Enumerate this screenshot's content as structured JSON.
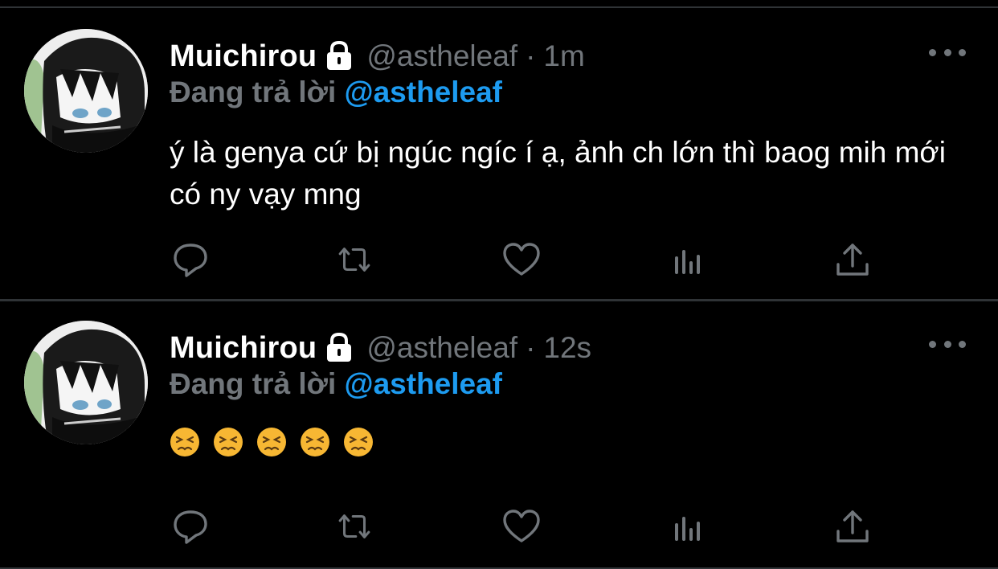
{
  "tweets": [
    {
      "name": "Muichirou",
      "handle": "@astheleaf",
      "separator": "·",
      "time": "1m",
      "reply_prefix": "Đang trả lời",
      "reply_handle": "@astheleaf",
      "text": "ý là genya cứ bị ngúc ngíc í ạ, ảnh ch lớn thì baog mih mới có ny vạy mng",
      "icons": [
        "lock-icon",
        "more-icon",
        "reply-icon",
        "retweet-icon",
        "like-icon",
        "analytics-icon",
        "share-icon"
      ]
    },
    {
      "name": "Muichirou",
      "handle": "@astheleaf",
      "separator": "·",
      "time": "12s",
      "reply_prefix": "Đang trả lời",
      "reply_handle": "@astheleaf",
      "emoji_count": 5,
      "emoji_name": "persevering-face",
      "icons": [
        "lock-icon",
        "more-icon",
        "reply-icon",
        "retweet-icon",
        "like-icon",
        "analytics-icon",
        "share-icon"
      ]
    }
  ],
  "colors": {
    "background": "#000000",
    "secondary_text": "#71767b",
    "accent": "#1d9bf0",
    "divider": "#2f3336"
  }
}
